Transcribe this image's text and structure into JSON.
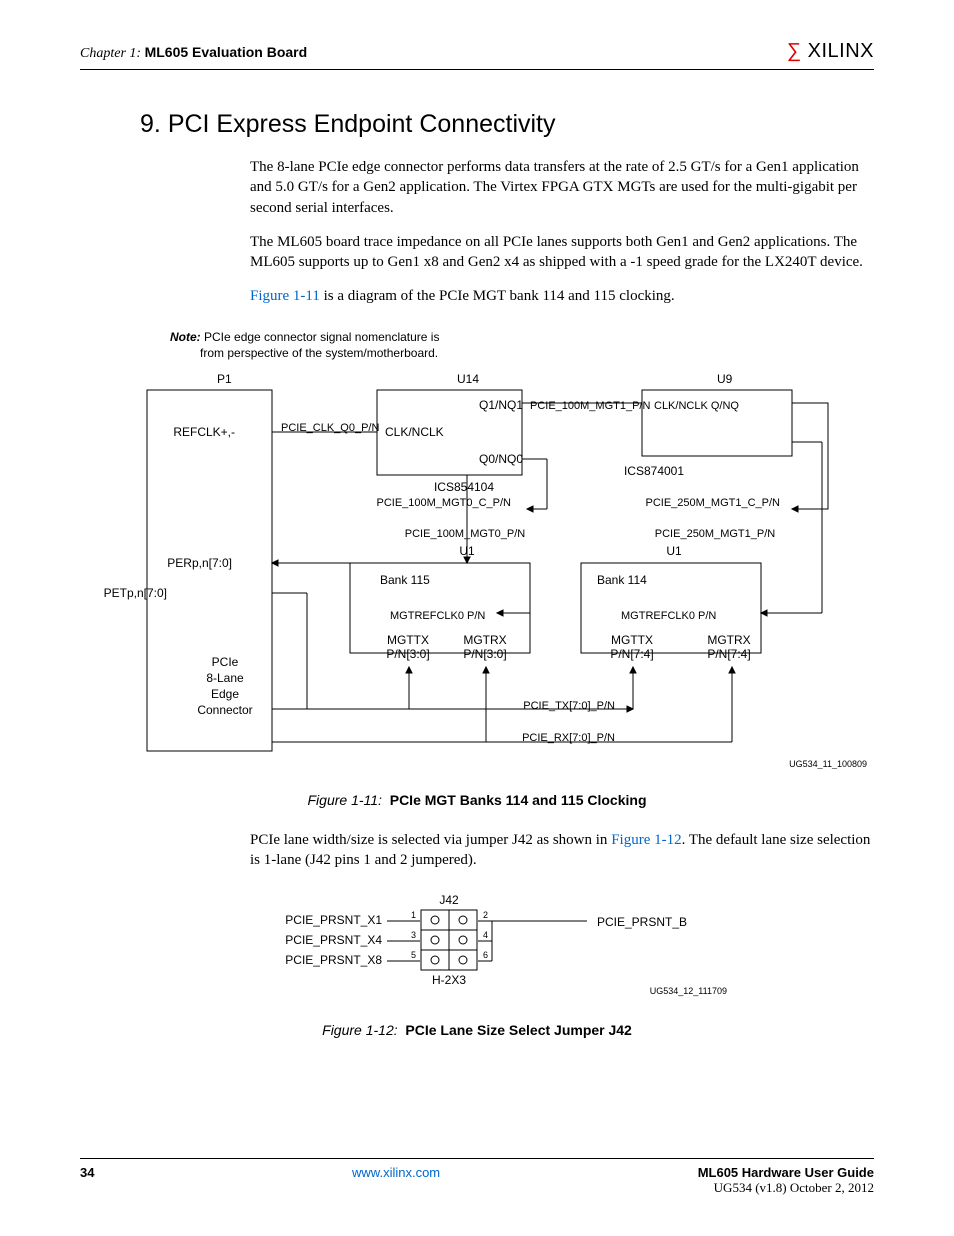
{
  "header": {
    "chapter": "Chapter 1:",
    "title": "ML605 Evaluation Board",
    "brand": "XILINX"
  },
  "section": {
    "num": "9.",
    "heading": "PCI Express Endpoint Connectivity"
  },
  "para1": "The 8-lane PCIe edge connector performs data transfers at the rate of 2.5 GT/s for a Gen1 application and 5.0 GT/s for a Gen2 application. The Virtex FPGA GTX MGTs are used for the multi-gigabit per second serial interfaces.",
  "para2": "The ML605 board trace impedance on all PCIe lanes supports both Gen1 and Gen2 applications. The ML605 supports up to Gen1 x8 and Gen2 x4 as shipped with a -1 speed grade for the LX240T device.",
  "para3_link": "Figure 1-11",
  "para3_rest": " is a diagram of the PCIe MGT bank 114 and 115 clocking.",
  "note_label": "Note:",
  "note_l1": " PCIe edge connector signal nomenclature is",
  "note_l2": "from perspective of the system/motherboard.",
  "fig11": {
    "P1": "P1",
    "U14": "U14",
    "U9": "U9",
    "q1": "Q1/NQ1",
    "pcie100mgt1": "PCIE_100M_MGT1_P/N",
    "clknclkqnq": "CLK/NCLK  Q/NQ",
    "refclk": "REFCLK+,-",
    "pcieclkq0": "PCIE_CLK_Q0_P/N",
    "clknclk": "CLK/NCLK",
    "q0": "Q0/NQ0",
    "ics874": "ICS874001",
    "ics854": "ICS854104",
    "pcie100c": "PCIE_100M_MGT0_C_P/N",
    "pcie250c": "PCIE_250M_MGT1_C_P/N",
    "pcie100": "PCIE_100M_MGT0_P/N",
    "pcie250": "PCIE_250M_MGT1_P/N",
    "u1a": "U1",
    "u1b": "U1",
    "perp": "PERp,n[7:0]",
    "petp": "PETp,n[7:0]",
    "b115": "Bank 115",
    "b114": "Bank 114",
    "mgtref0a": "MGTREFCLK0 P/N",
    "mgtref0b": "MGTREFCLK0 P/N",
    "mgttxa": "MGTTX",
    "mgttxa2": "P/N[3:0]",
    "mgtrxa": "MGTRX",
    "mgtrxa2": "P/N[3:0]",
    "mgttxb": "MGTTX",
    "mgttxb2": "P/N[7:4]",
    "mgtrxb": "MGTRX",
    "mgtrxb2": "P/N[7:4]",
    "pcie_l1": "PCIe",
    "pcie_l2": "8-Lane",
    "pcie_l3": "Edge",
    "pcie_l4": "Connector",
    "pcietx": "PCIE_TX[7:0]_P/N",
    "pcierx": "PCIE_RX[7:0]_P/N",
    "tag": "UG534_11_100809",
    "cap_num": "Figure 1-11:",
    "cap": "PCIe MGT Banks 114 and 115 Clocking"
  },
  "para4_a": "PCIe lane width/size is selected via jumper J42 as shown in ",
  "para4_link": "Figure 1-12",
  "para4_b": ". The default lane size selection is 1-lane (J42 pins 1 and 2 jumpered).",
  "fig12": {
    "j42": "J42",
    "x1": "PCIE_PRSNT_X1",
    "x4": "PCIE_PRSNT_X4",
    "x8": "PCIE_PRSNT_X8",
    "n1": "1",
    "n2": "2",
    "n3": "3",
    "n4": "4",
    "n5": "5",
    "n6": "6",
    "prsntb": "PCIE_PRSNT_B",
    "h2x3": "H-2X3",
    "tag": "UG534_12_111709",
    "cap_num": "Figure 1-12:",
    "cap": "PCIe Lane Size Select Jumper J42"
  },
  "footer": {
    "page": "34",
    "url": "www.xilinx.com",
    "guide": "ML605 Hardware User Guide",
    "ver": "UG534 (v1.8) October 2, 2012"
  }
}
